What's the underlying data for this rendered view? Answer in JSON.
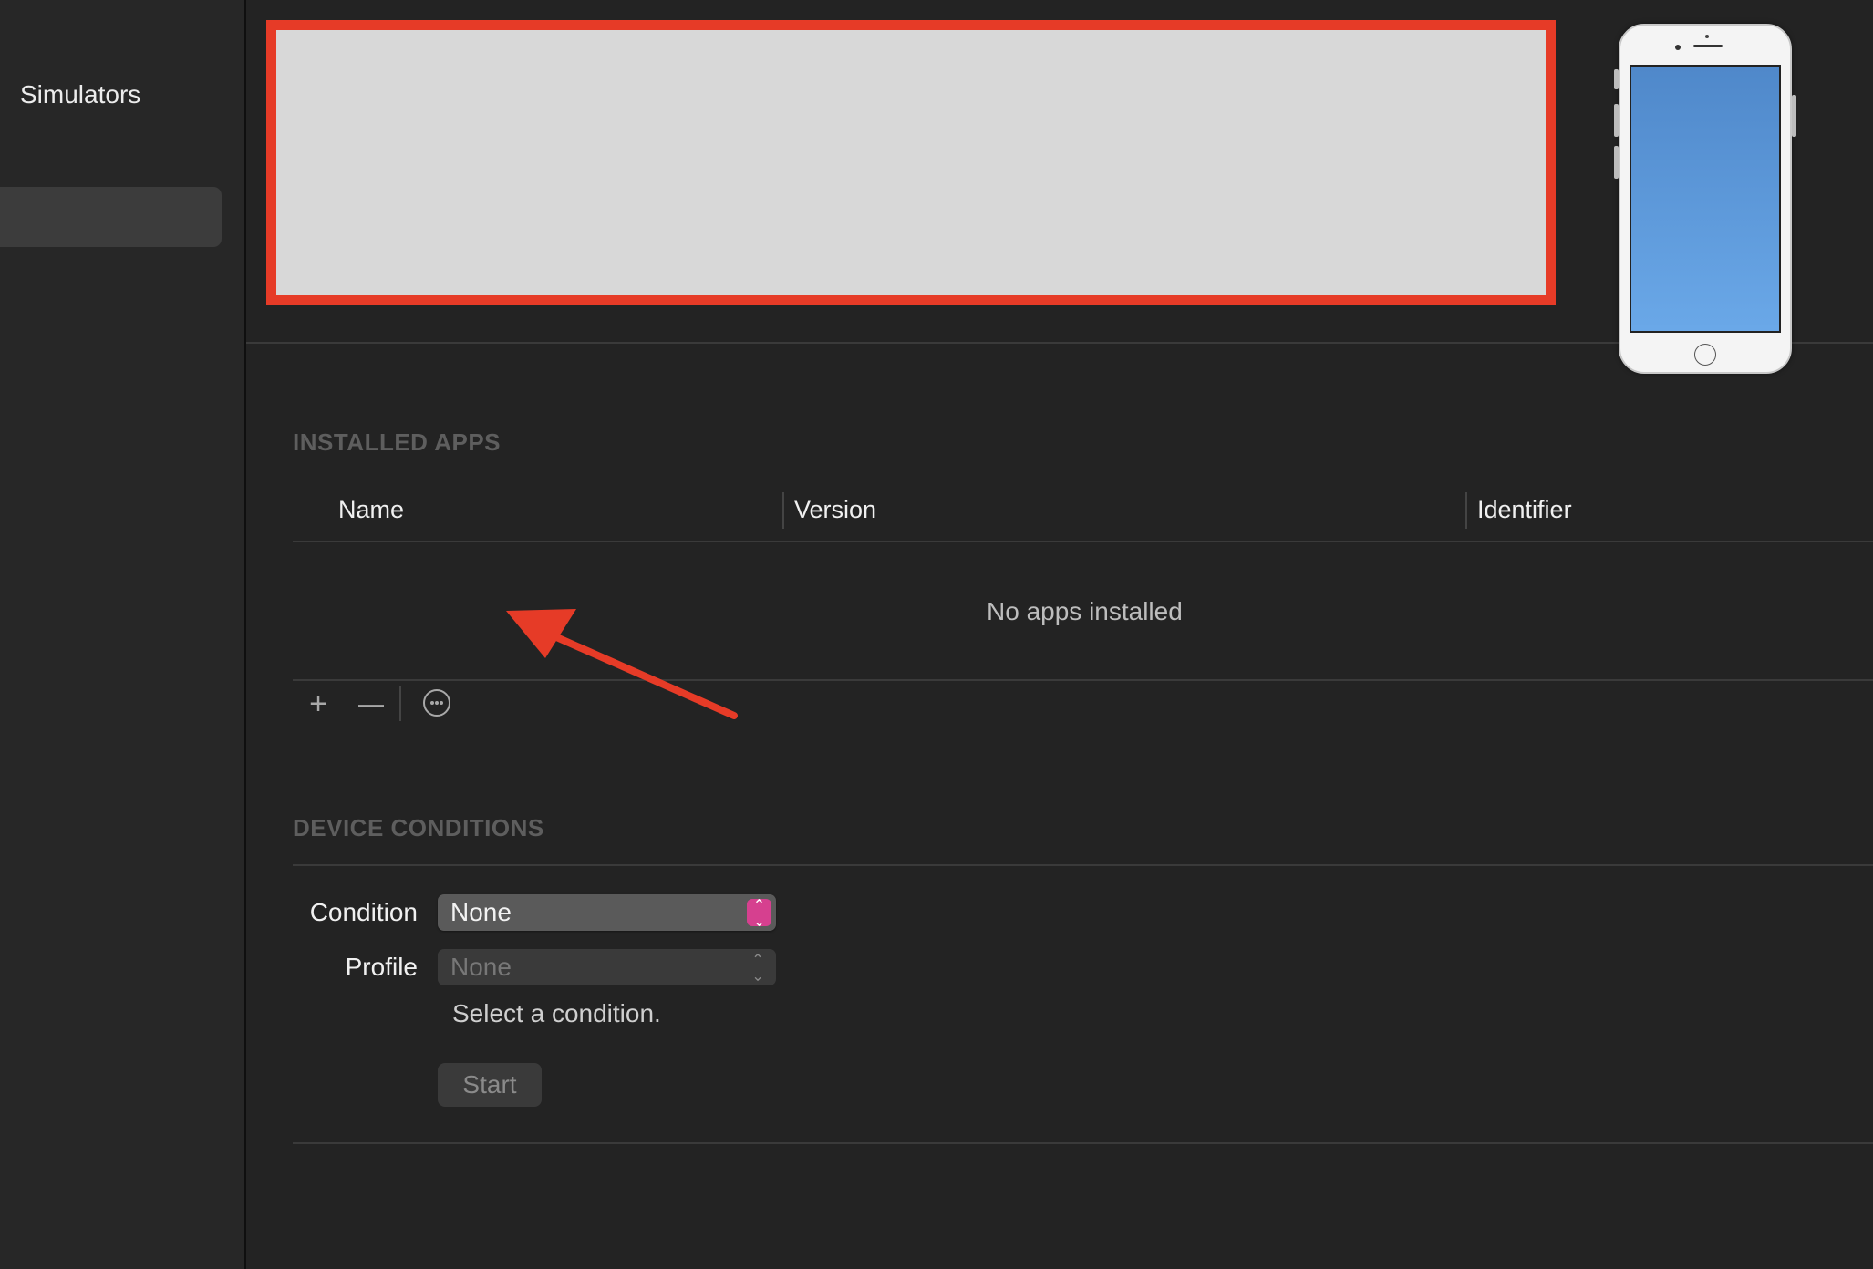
{
  "sidebar": {
    "title": "Simulators"
  },
  "installed_apps": {
    "section_title": "INSTALLED APPS",
    "columns": [
      "Name",
      "Version",
      "Identifier"
    ],
    "empty_message": "No apps installed",
    "toolbar": {
      "add_label": "+",
      "remove_label": "—"
    }
  },
  "device_conditions": {
    "section_title": "DEVICE CONDITIONS",
    "condition_label": "Condition",
    "condition_value": "None",
    "profile_label": "Profile",
    "profile_value": "None",
    "hint": "Select a condition.",
    "start_label": "Start"
  },
  "colors": {
    "annotation_red": "#e63b27",
    "stepper_accent": "#d6408f",
    "device_screen": "#5b96d8"
  }
}
